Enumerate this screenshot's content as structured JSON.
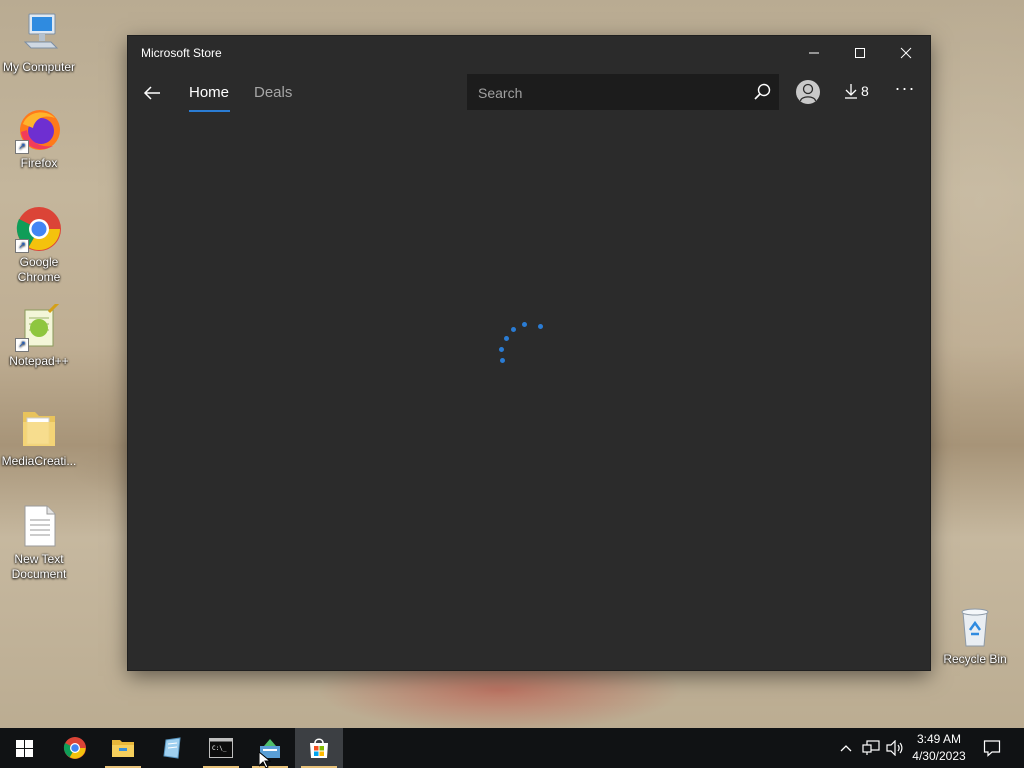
{
  "desktop": {
    "icons": [
      {
        "label": "My Computer",
        "icon": "computer-icon"
      },
      {
        "label": "Firefox",
        "icon": "firefox-icon"
      },
      {
        "label": "Google Chrome",
        "icon": "chrome-icon"
      },
      {
        "label": "Notepad++",
        "icon": "notepadpp-icon"
      },
      {
        "label": "MediaCreati...",
        "icon": "folder-icon"
      },
      {
        "label": "New Text Document",
        "icon": "text-document-icon"
      },
      {
        "label": "Recycle Bin",
        "icon": "recycle-bin-icon"
      }
    ]
  },
  "window": {
    "title": "Microsoft Store",
    "controls": {
      "minimize": "minimize-icon",
      "maximize": "maximize-icon",
      "close": "close-icon"
    },
    "nav": {
      "back": "back-arrow-icon",
      "tabs": [
        {
          "label": "Home",
          "active": true
        },
        {
          "label": "Deals",
          "active": false
        }
      ]
    },
    "search": {
      "placeholder": "Search",
      "value": "",
      "icon": "search-icon"
    },
    "account_icon": "user-icon",
    "downloads": {
      "icon": "download-icon",
      "count": "8"
    },
    "more": "···",
    "content": {
      "state": "loading",
      "spinner_icon": "loading-spinner-icon"
    }
  },
  "taskbar": {
    "start": "windows-start-icon",
    "apps": [
      {
        "name": "Google Chrome",
        "icon": "chrome-icon",
        "running": false
      },
      {
        "name": "File Explorer",
        "icon": "folder-icon",
        "running": true
      },
      {
        "name": "App",
        "icon": "app-icon",
        "running": false
      },
      {
        "name": "Command Prompt",
        "icon": "terminal-icon",
        "running": true
      },
      {
        "name": "App",
        "icon": "installer-icon",
        "running": true
      },
      {
        "name": "Microsoft Store",
        "icon": "store-icon",
        "running": true,
        "active": true
      }
    ],
    "tray": {
      "icons": [
        "chevron-up-icon",
        "network-icon",
        "volume-icon"
      ],
      "time": "3:49 AM",
      "date": "4/30/2023",
      "notification_icon": "notification-icon"
    }
  },
  "colors": {
    "accent": "#2a7cd4",
    "window_bg": "#2b2b2b",
    "search_bg": "#1c1c1c",
    "taskbar_bg": "#101214"
  }
}
